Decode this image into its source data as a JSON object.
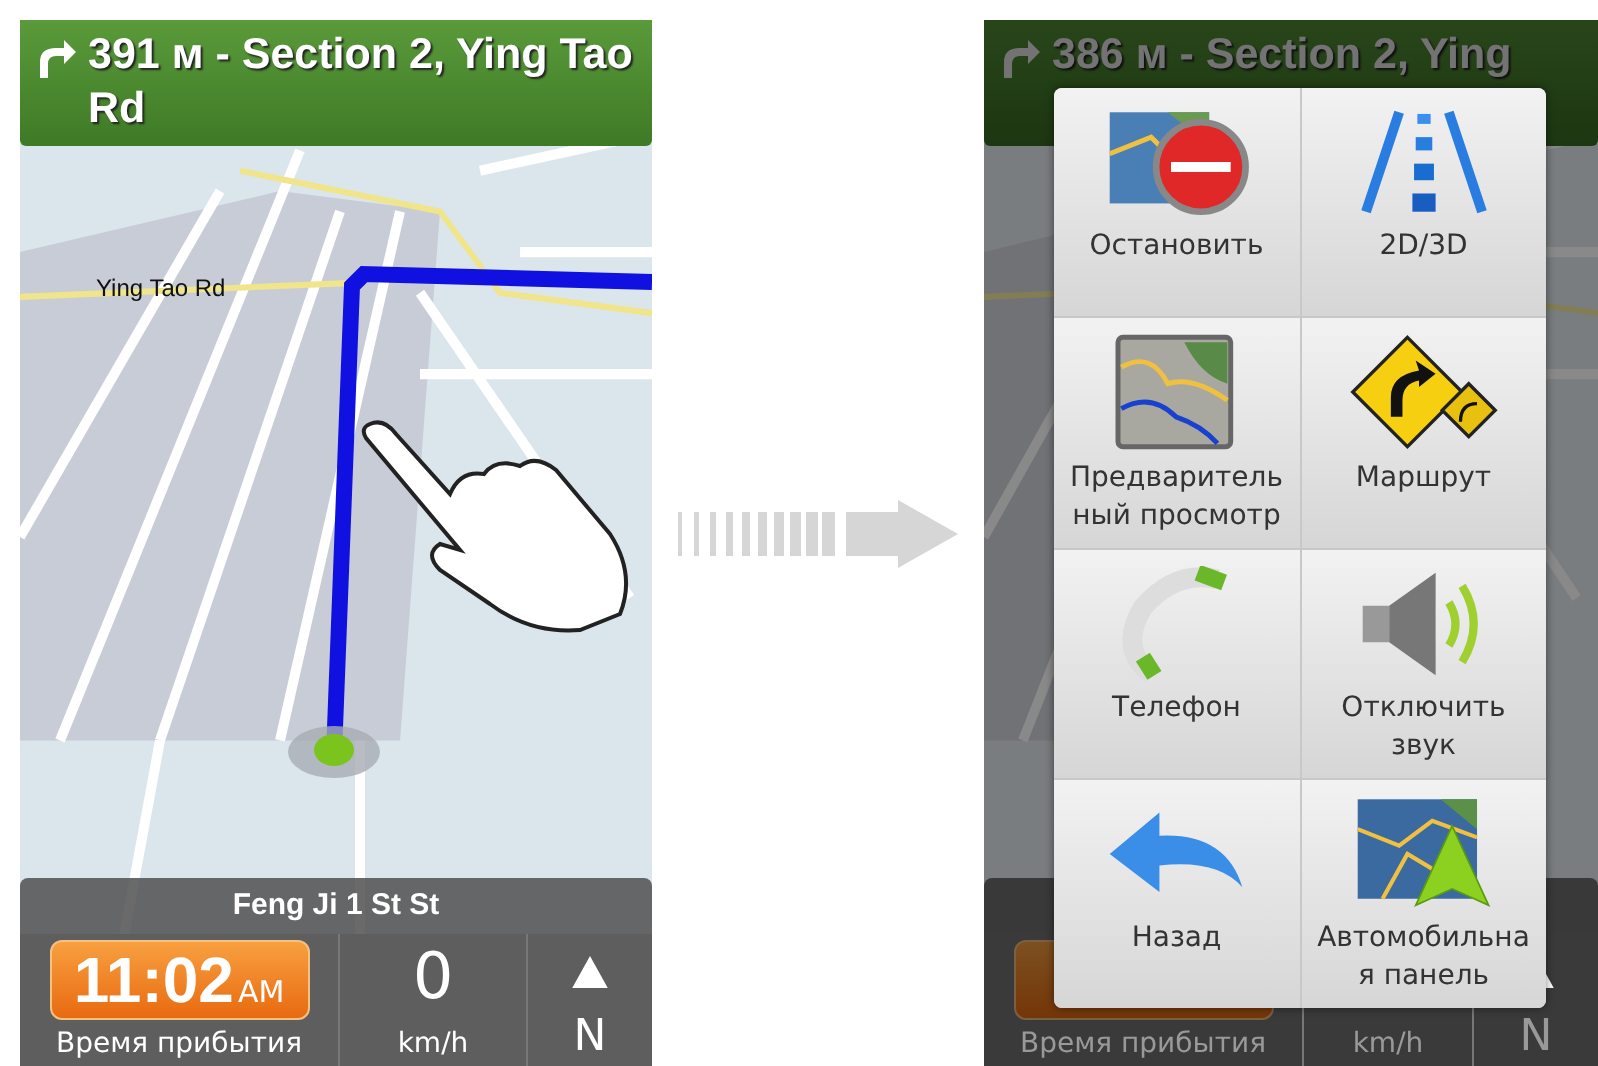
{
  "screens": [
    {
      "header": {
        "text": "391 м - Section 2, Ying Tao Rd"
      },
      "road_label": "Ying Tao Rd",
      "street": "Feng Ji 1 St St",
      "eta": {
        "time": "11:02",
        "ampm": "AM",
        "label": "Время прибытия"
      },
      "speed": {
        "value": "0",
        "unit": "km/h"
      },
      "heading": "N"
    },
    {
      "header": {
        "text": "386 м - Section 2, Ying"
      },
      "eta": {
        "label": "Время прибытия"
      },
      "speed": {
        "unit": "km/h"
      },
      "heading": "N",
      "menu": [
        {
          "kind": "stop",
          "label": "Остановить"
        },
        {
          "kind": "view",
          "label": "2D/3D"
        },
        {
          "kind": "preview",
          "label": "Предваритель ный просмотр"
        },
        {
          "kind": "route",
          "label": "Маршрут"
        },
        {
          "kind": "phone",
          "label": "Телефон"
        },
        {
          "kind": "mute",
          "label": "Отключить звук"
        },
        {
          "kind": "back",
          "label": "Назад"
        },
        {
          "kind": "dashboard",
          "label": "Автомобильна я панель"
        }
      ]
    }
  ]
}
